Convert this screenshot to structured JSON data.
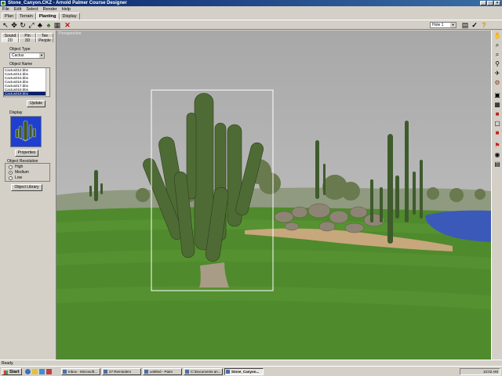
{
  "window": {
    "title": "Stone_Canyon.CKZ - Arnold Palmer Course Designer"
  },
  "menu": [
    "File",
    "Edit",
    "Select",
    "Render",
    "Help"
  ],
  "mode_tabs": [
    "Plan",
    "Terrain",
    "Planting",
    "Display"
  ],
  "active_mode_tab": "Planting",
  "toolbar": {
    "hole_select": "Hole 1"
  },
  "left_panel": {
    "tabs_row1": [
      "Sound",
      "Pin",
      "Tee"
    ],
    "tabs_row2": [
      "2D",
      "3D",
      "People"
    ],
    "object_type_label": "Object Type",
    "object_type_value": "Cactus",
    "object_name_label": "Object Name",
    "object_names": [
      "Cactus012.bbs",
      "Cactus014.bbs",
      "Cactus015.bbs",
      "Cactus016.bbs",
      "Cactus017.bbs",
      "Cactus018.bbs",
      "Cactus019.bbs"
    ],
    "selected_object_index": 6,
    "update_button": "Update",
    "display_label": "Display",
    "properties_button": "Properties",
    "resolution_label": "Object Resolution",
    "resolution_options": [
      "High",
      "Medium",
      "Low"
    ],
    "resolution_selected": "Medium",
    "library_button": "Object Library"
  },
  "viewport": {
    "label": "Perspective"
  },
  "status": {
    "text": "Ready."
  },
  "taskbar": {
    "start_label": "Start",
    "tasks": [
      "Inbox - Microsoft...",
      "27 Reminders",
      "untitled - Paint",
      "C:\\Documents an...",
      "Stone_Canyon..."
    ],
    "active_task_index": 4,
    "clock": "10:02 AM"
  },
  "colors": {
    "titlebar": "#0a246a",
    "sky": "#acacac",
    "grass": "#4f8a2c",
    "water": "#3b59b8",
    "selection_box": "#ffffff"
  }
}
